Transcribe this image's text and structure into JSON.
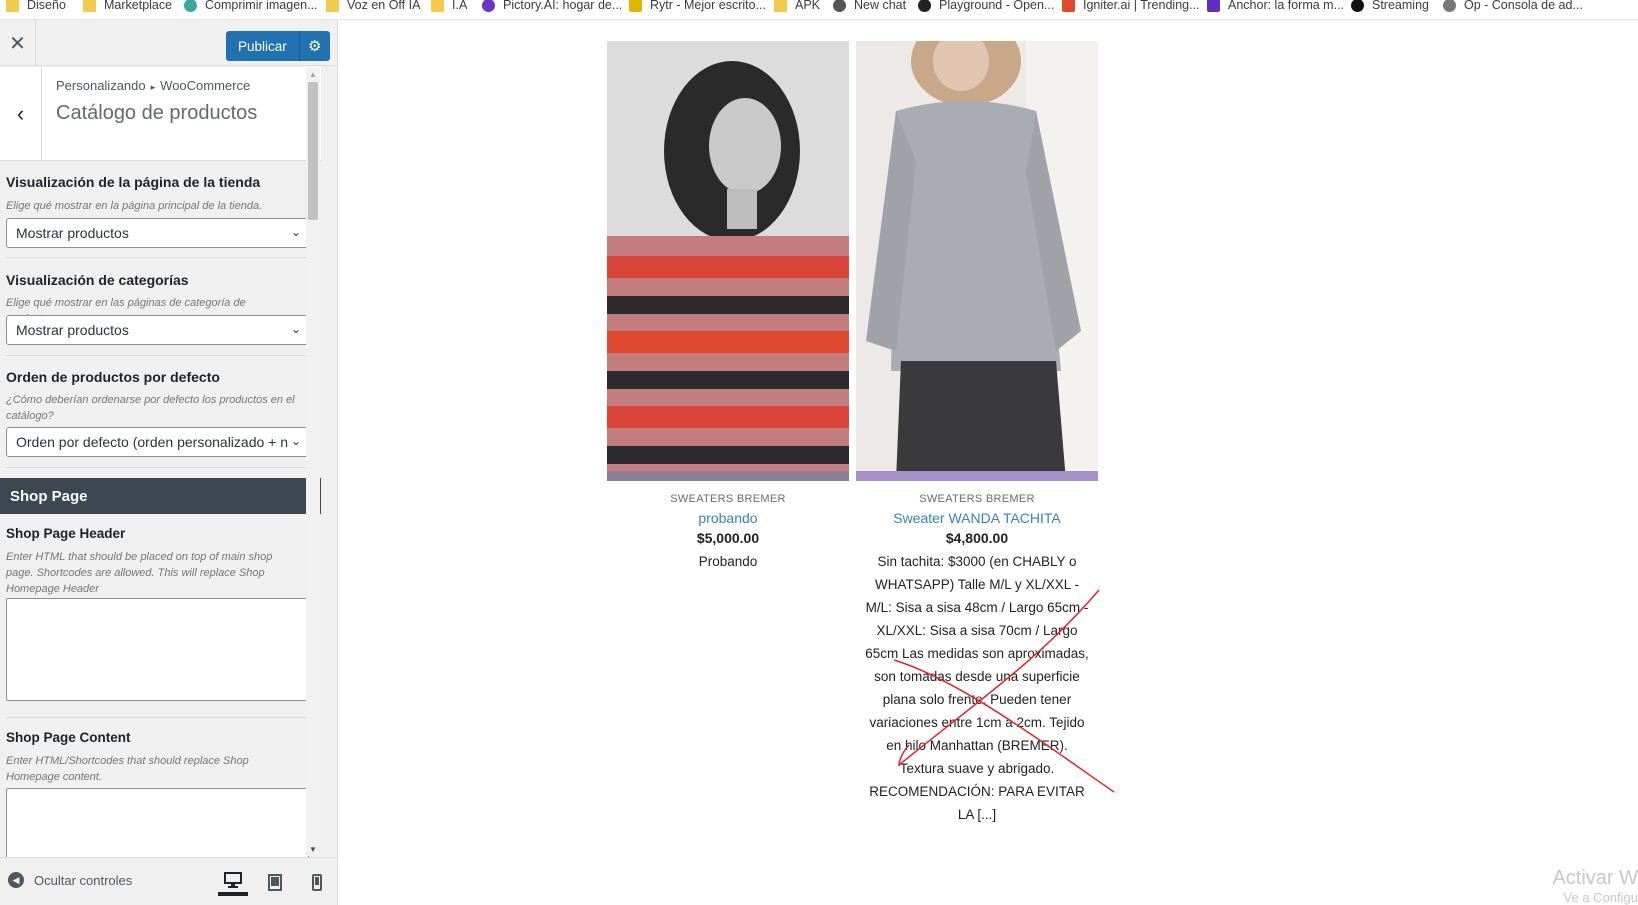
{
  "bookmarks": [
    {
      "label": "Diseño",
      "icon": "folder-icon",
      "color": "#f6c94b"
    },
    {
      "label": "Marketplace",
      "icon": "folder-icon",
      "color": "#f6c94b"
    },
    {
      "label": "Comprimir imagen...",
      "icon": "compress-icon",
      "color": "#3aa7a0"
    },
    {
      "label": "Voz en Off IA",
      "icon": "folder-icon",
      "color": "#f6c94b"
    },
    {
      "label": "I.A",
      "icon": "folder-icon",
      "color": "#f6c94b"
    },
    {
      "label": "Pictory.AI: hogar de...",
      "icon": "pictory-icon",
      "color": "#6b35c8"
    },
    {
      "label": "Rytr - Mejor escrito...",
      "icon": "rytr-icon",
      "color": "#e0b400"
    },
    {
      "label": "APK",
      "icon": "folder-icon",
      "color": "#f6c94b"
    },
    {
      "label": "New chat",
      "icon": "chat-icon",
      "color": "#555555"
    },
    {
      "label": "Playground - Open...",
      "icon": "openai-icon",
      "color": "#222222"
    },
    {
      "label": "Igniter.ai | Trending...",
      "icon": "igniter-icon",
      "color": "#e04a2a"
    },
    {
      "label": "Anchor: la forma m...",
      "icon": "anchor-icon",
      "color": "#5c2fc2"
    },
    {
      "label": "Streaming",
      "icon": "streaming-icon",
      "color": "#111111"
    },
    {
      "label": "Op - Consola de ad...",
      "icon": "console-icon",
      "color": "#777777"
    }
  ],
  "customizer": {
    "publish_label": "Publicar",
    "breadcrumb": {
      "root": "Personalizando",
      "current": "WooCommerce"
    },
    "section_title": "Catálogo de productos",
    "controls": [
      {
        "title": "Visualización de la página de la tienda",
        "description": "Elige qué mostrar en la página principal de la tienda.",
        "value": "Mostrar productos"
      },
      {
        "title": "Visualización de categorías",
        "description": "Elige qué mostrar en las páginas de categoría de productos.",
        "value": "Mostrar productos"
      },
      {
        "title": "Orden de productos por defecto",
        "description": "¿Cómo deberían ordenarse por defecto los productos en el catálogo?",
        "value": "Orden por defecto (orden personalizado + n"
      }
    ],
    "shop_page_banner": "Shop Page",
    "shop_page_header": {
      "title": "Shop Page Header",
      "description": "Enter HTML that should be placed on top of main shop page. Shortcodes are allowed. This will replace Shop Homepage Header"
    },
    "shop_page_content": {
      "title": "Shop Page Content",
      "description": "Enter HTML/Shortcodes that should replace Shop Homepage content."
    },
    "hide_controls_label": "Ocultar controles"
  },
  "products": [
    {
      "category": "SWEATERS BREMER",
      "name": "probando",
      "price": "$5,000.00",
      "description": "Probando"
    },
    {
      "category": "SWEATERS BREMER",
      "name": "Sweater WANDA TACHITA",
      "price": "$4,800.00",
      "description": "Sin tachita: $3000 (en CHABLY o WHATSAPP) Talle M/L y XL/XXL -M/L: Sisa a sisa 48cm / Largo 65cm -XL/XXL: Sisa a sisa 70cm / Largo 65cm Las medidas son aproximadas, son tomadas desde una superficie plana solo frente. Pueden tener variaciones entre 1cm a 2cm. Tejido en hilo Manhattan (BREMER). Textura suave y abrigado. RECOMENDACIÓN: PARA EVITAR LA [...]"
    }
  ],
  "windows_watermark": {
    "line1": "Activar W",
    "line2": "Ve a Configu"
  },
  "colors": {
    "primary": "#2271b1",
    "banner": "#3c4752",
    "link": "#3a7fc1",
    "annotation": "#e0262b"
  }
}
